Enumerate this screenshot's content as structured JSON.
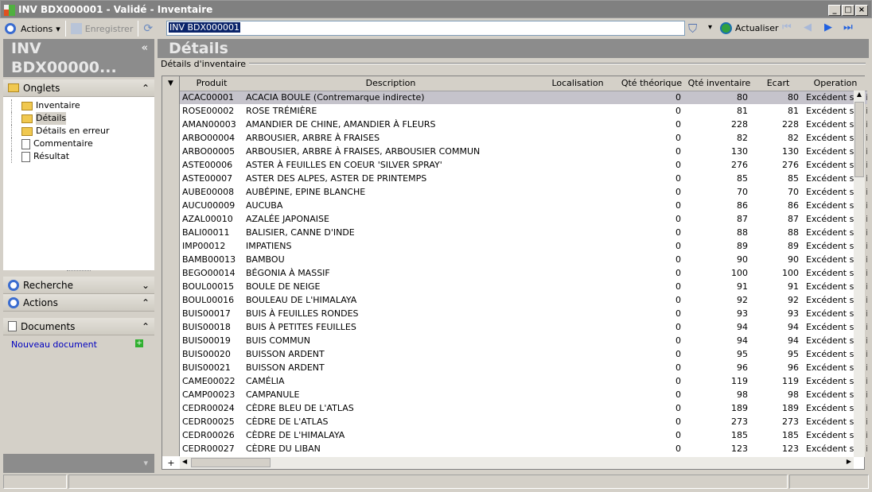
{
  "window": {
    "title": "INV BDX000001 - Validé -  Inventaire",
    "minimize": "_",
    "maximize": "□",
    "close": "×"
  },
  "toolbar": {
    "actions": "Actions",
    "save": "Enregistrer",
    "search_value": "INV BDX000001",
    "refresh": "Actualiser"
  },
  "left": {
    "header": "INV BDX00000...",
    "collapse": "«",
    "onglets": {
      "label": "Onglets",
      "items": [
        "Inventaire",
        "Détails",
        "Détails en erreur",
        "Commentaire",
        "Résultat"
      ],
      "selected": "Détails"
    },
    "recherche": "Recherche",
    "actions": "Actions",
    "documents": "Documents",
    "new_document": "Nouveau document"
  },
  "main": {
    "header": "Détails",
    "group": "Détails d'inventaire",
    "columns": [
      "Produit",
      "Description",
      "Localisation",
      "Qté théorique",
      "Qté inventaire",
      "Ecart",
      "Operation"
    ],
    "rows": [
      [
        "ACAC00001",
        "ACACIA BOULE (Contremarque indirecte)",
        "",
        "0",
        "80",
        "80",
        "Excédent sur inventaire"
      ],
      [
        "ROSE00002",
        "ROSE TRÉMIÈRE",
        "",
        "0",
        "81",
        "81",
        "Excédent sur inventaire"
      ],
      [
        "AMAN00003",
        "AMANDIER DE CHINE, AMANDIER À FLEURS",
        "",
        "0",
        "228",
        "228",
        "Excédent sur inventaire"
      ],
      [
        "ARBO00004",
        "ARBOUSIER, ARBRE À FRAISES",
        "",
        "0",
        "82",
        "82",
        "Excédent sur inventaire"
      ],
      [
        "ARBO00005",
        "ARBOUSIER, ARBRE À FRAISES, ARBOUSIER COMMUN",
        "",
        "0",
        "130",
        "130",
        "Excédent sur inventaire"
      ],
      [
        "ASTE00006",
        "ASTER À FEUILLES EN COEUR 'SILVER SPRAY'",
        "",
        "0",
        "276",
        "276",
        "Excédent sur inventaire"
      ],
      [
        "ASTE00007",
        "ASTER DES ALPES, ASTER DE PRINTEMPS",
        "",
        "0",
        "85",
        "85",
        "Excédent sur inventaire"
      ],
      [
        "AUBE00008",
        "AUBÉPINE, EPINE BLANCHE",
        "",
        "0",
        "70",
        "70",
        "Excédent sur inventaire"
      ],
      [
        "AUCU00009",
        "AUCUBA",
        "",
        "0",
        "86",
        "86",
        "Excédent sur inventaire"
      ],
      [
        "AZAL00010",
        "AZALÉE JAPONAISE",
        "",
        "0",
        "87",
        "87",
        "Excédent sur inventaire"
      ],
      [
        "BALI00011",
        "BALISIER, CANNE D'INDE",
        "",
        "0",
        "88",
        "88",
        "Excédent sur inventaire"
      ],
      [
        "IMP00012",
        "IMPATIENS",
        "",
        "0",
        "89",
        "89",
        "Excédent sur inventaire"
      ],
      [
        "BAMB00013",
        "BAMBOU",
        "",
        "0",
        "90",
        "90",
        "Excédent sur inventaire"
      ],
      [
        "BEGO00014",
        "BÉGONIA À MASSIF",
        "",
        "0",
        "100",
        "100",
        "Excédent sur inventaire"
      ],
      [
        "BOUL00015",
        "BOULE DE NEIGE",
        "",
        "0",
        "91",
        "91",
        "Excédent sur inventaire"
      ],
      [
        "BOUL00016",
        "BOULEAU DE L'HIMALAYA",
        "",
        "0",
        "92",
        "92",
        "Excédent sur inventaire"
      ],
      [
        "BUIS00017",
        "BUIS À FEUILLES RONDES",
        "",
        "0",
        "93",
        "93",
        "Excédent sur inventaire"
      ],
      [
        "BUIS00018",
        "BUIS À PETITES FEUILLES",
        "",
        "0",
        "94",
        "94",
        "Excédent sur inventaire"
      ],
      [
        "BUIS00019",
        "BUIS COMMUN",
        "",
        "0",
        "94",
        "94",
        "Excédent sur inventaire"
      ],
      [
        "BUIS00020",
        "BUISSON ARDENT",
        "",
        "0",
        "95",
        "95",
        "Excédent sur inventaire"
      ],
      [
        "BUIS00021",
        "BUISSON ARDENT",
        "",
        "0",
        "96",
        "96",
        "Excédent sur inventaire"
      ],
      [
        "CAME00022",
        "CAMÉLIA",
        "",
        "0",
        "119",
        "119",
        "Excédent sur inventaire"
      ],
      [
        "CAMP00023",
        "CAMPANULE",
        "",
        "0",
        "98",
        "98",
        "Excédent sur inventaire"
      ],
      [
        "CEDR00024",
        "CÈDRE BLEU DE L'ATLAS",
        "",
        "0",
        "189",
        "189",
        "Excédent sur inventaire"
      ],
      [
        "CEDR00025",
        "CÈDRE DE L'ATLAS",
        "",
        "0",
        "273",
        "273",
        "Excédent sur inventaire"
      ],
      [
        "CEDR00026",
        "CÈDRE DE L'HIMALAYA",
        "",
        "0",
        "185",
        "185",
        "Excédent sur inventaire"
      ],
      [
        "CEDR00027",
        "CÈDRE DU LIBAN",
        "",
        "0",
        "123",
        "123",
        "Excédent sur inventaire"
      ]
    ],
    "add_row": "+"
  }
}
